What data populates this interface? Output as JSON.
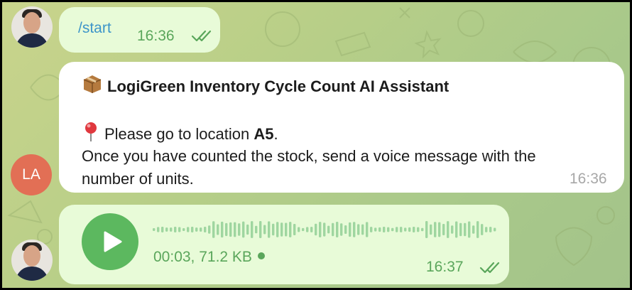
{
  "chat": {
    "messages": [
      {
        "type": "command",
        "text": "/start",
        "time": "16:36",
        "status": "read"
      },
      {
        "type": "bot",
        "avatar_initials": "LA",
        "title_icon": "package-icon",
        "title": "LogiGreen Inventory Cycle Count AI Assistant",
        "location_icon": "round-pushpin-icon",
        "location_prefix": "Please go to location ",
        "location": "A5",
        "location_suffix": ".",
        "line2": "Once you have counted the stock, send a voice message with the",
        "line3": "number of units.",
        "time": "16:36"
      },
      {
        "type": "voice",
        "duration": "00:03",
        "size": "71.2 KB",
        "meta": "00:03, 71.2 KB",
        "time": "16:37",
        "status": "read"
      }
    ]
  },
  "colors": {
    "outgoing_bubble": "#e8fbd8",
    "incoming_bubble": "#ffffff",
    "accent_green": "#5aa65b",
    "link_blue": "#3d95c9",
    "bot_avatar": "#e26f55"
  }
}
